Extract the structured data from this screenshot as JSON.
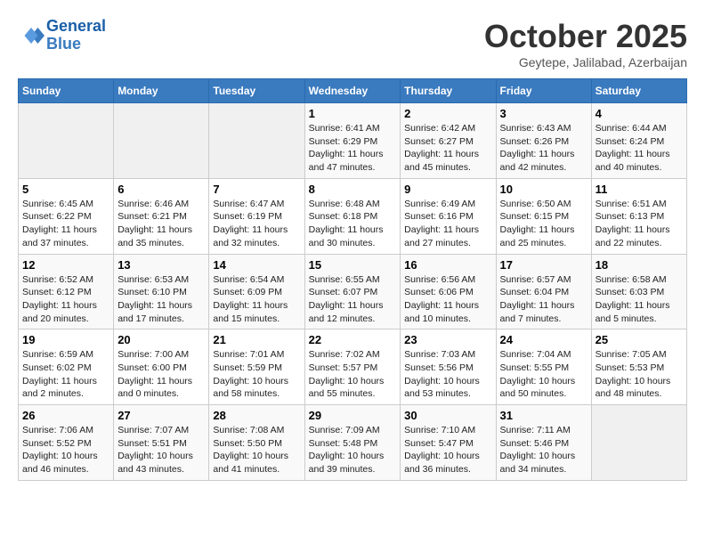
{
  "header": {
    "logo_line1": "General",
    "logo_line2": "Blue",
    "month": "October 2025",
    "location": "Geytepe, Jalilabad, Azerbaijan"
  },
  "weekdays": [
    "Sunday",
    "Monday",
    "Tuesday",
    "Wednesday",
    "Thursday",
    "Friday",
    "Saturday"
  ],
  "weeks": [
    [
      {
        "day": "",
        "info": ""
      },
      {
        "day": "",
        "info": ""
      },
      {
        "day": "",
        "info": ""
      },
      {
        "day": "1",
        "info": "Sunrise: 6:41 AM\nSunset: 6:29 PM\nDaylight: 11 hours\nand 47 minutes."
      },
      {
        "day": "2",
        "info": "Sunrise: 6:42 AM\nSunset: 6:27 PM\nDaylight: 11 hours\nand 45 minutes."
      },
      {
        "day": "3",
        "info": "Sunrise: 6:43 AM\nSunset: 6:26 PM\nDaylight: 11 hours\nand 42 minutes."
      },
      {
        "day": "4",
        "info": "Sunrise: 6:44 AM\nSunset: 6:24 PM\nDaylight: 11 hours\nand 40 minutes."
      }
    ],
    [
      {
        "day": "5",
        "info": "Sunrise: 6:45 AM\nSunset: 6:22 PM\nDaylight: 11 hours\nand 37 minutes."
      },
      {
        "day": "6",
        "info": "Sunrise: 6:46 AM\nSunset: 6:21 PM\nDaylight: 11 hours\nand 35 minutes."
      },
      {
        "day": "7",
        "info": "Sunrise: 6:47 AM\nSunset: 6:19 PM\nDaylight: 11 hours\nand 32 minutes."
      },
      {
        "day": "8",
        "info": "Sunrise: 6:48 AM\nSunset: 6:18 PM\nDaylight: 11 hours\nand 30 minutes."
      },
      {
        "day": "9",
        "info": "Sunrise: 6:49 AM\nSunset: 6:16 PM\nDaylight: 11 hours\nand 27 minutes."
      },
      {
        "day": "10",
        "info": "Sunrise: 6:50 AM\nSunset: 6:15 PM\nDaylight: 11 hours\nand 25 minutes."
      },
      {
        "day": "11",
        "info": "Sunrise: 6:51 AM\nSunset: 6:13 PM\nDaylight: 11 hours\nand 22 minutes."
      }
    ],
    [
      {
        "day": "12",
        "info": "Sunrise: 6:52 AM\nSunset: 6:12 PM\nDaylight: 11 hours\nand 20 minutes."
      },
      {
        "day": "13",
        "info": "Sunrise: 6:53 AM\nSunset: 6:10 PM\nDaylight: 11 hours\nand 17 minutes."
      },
      {
        "day": "14",
        "info": "Sunrise: 6:54 AM\nSunset: 6:09 PM\nDaylight: 11 hours\nand 15 minutes."
      },
      {
        "day": "15",
        "info": "Sunrise: 6:55 AM\nSunset: 6:07 PM\nDaylight: 11 hours\nand 12 minutes."
      },
      {
        "day": "16",
        "info": "Sunrise: 6:56 AM\nSunset: 6:06 PM\nDaylight: 11 hours\nand 10 minutes."
      },
      {
        "day": "17",
        "info": "Sunrise: 6:57 AM\nSunset: 6:04 PM\nDaylight: 11 hours\nand 7 minutes."
      },
      {
        "day": "18",
        "info": "Sunrise: 6:58 AM\nSunset: 6:03 PM\nDaylight: 11 hours\nand 5 minutes."
      }
    ],
    [
      {
        "day": "19",
        "info": "Sunrise: 6:59 AM\nSunset: 6:02 PM\nDaylight: 11 hours\nand 2 minutes."
      },
      {
        "day": "20",
        "info": "Sunrise: 7:00 AM\nSunset: 6:00 PM\nDaylight: 11 hours\nand 0 minutes."
      },
      {
        "day": "21",
        "info": "Sunrise: 7:01 AM\nSunset: 5:59 PM\nDaylight: 10 hours\nand 58 minutes."
      },
      {
        "day": "22",
        "info": "Sunrise: 7:02 AM\nSunset: 5:57 PM\nDaylight: 10 hours\nand 55 minutes."
      },
      {
        "day": "23",
        "info": "Sunrise: 7:03 AM\nSunset: 5:56 PM\nDaylight: 10 hours\nand 53 minutes."
      },
      {
        "day": "24",
        "info": "Sunrise: 7:04 AM\nSunset: 5:55 PM\nDaylight: 10 hours\nand 50 minutes."
      },
      {
        "day": "25",
        "info": "Sunrise: 7:05 AM\nSunset: 5:53 PM\nDaylight: 10 hours\nand 48 minutes."
      }
    ],
    [
      {
        "day": "26",
        "info": "Sunrise: 7:06 AM\nSunset: 5:52 PM\nDaylight: 10 hours\nand 46 minutes."
      },
      {
        "day": "27",
        "info": "Sunrise: 7:07 AM\nSunset: 5:51 PM\nDaylight: 10 hours\nand 43 minutes."
      },
      {
        "day": "28",
        "info": "Sunrise: 7:08 AM\nSunset: 5:50 PM\nDaylight: 10 hours\nand 41 minutes."
      },
      {
        "day": "29",
        "info": "Sunrise: 7:09 AM\nSunset: 5:48 PM\nDaylight: 10 hours\nand 39 minutes."
      },
      {
        "day": "30",
        "info": "Sunrise: 7:10 AM\nSunset: 5:47 PM\nDaylight: 10 hours\nand 36 minutes."
      },
      {
        "day": "31",
        "info": "Sunrise: 7:11 AM\nSunset: 5:46 PM\nDaylight: 10 hours\nand 34 minutes."
      },
      {
        "day": "",
        "info": ""
      }
    ]
  ]
}
